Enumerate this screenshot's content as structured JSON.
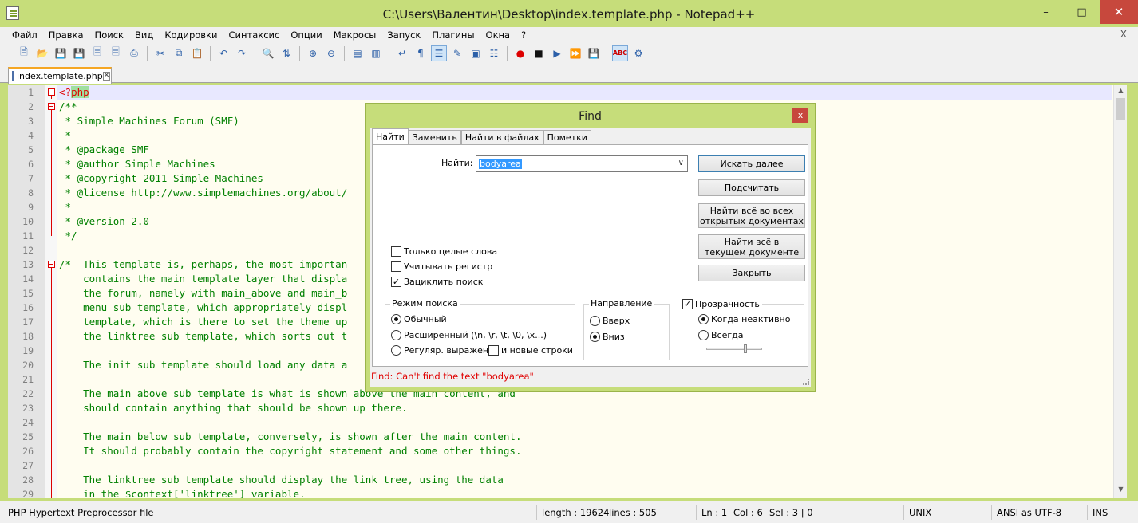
{
  "window": {
    "title": "C:\\Users\\Валентин\\Desktop\\index.template.php - Notepad++"
  },
  "menu": {
    "items": [
      "Файл",
      "Правка",
      "Поиск",
      "Вид",
      "Кодировки",
      "Синтаксис",
      "Опции",
      "Макросы",
      "Запуск",
      "Плагины",
      "Окна",
      "?"
    ],
    "close": "X"
  },
  "tab": {
    "label": "index.template.php"
  },
  "editor": {
    "lines": [
      "<?php",
      "/**",
      " * Simple Machines Forum (SMF)",
      " *",
      " * @package SMF",
      " * @author Simple Machines",
      " * @copyright 2011 Simple Machines",
      " * @license http://www.simplemachines.org/about/",
      " *",
      " * @version 2.0",
      " */",
      "",
      "/*  This template is, perhaps, the most importan",
      "    contains the main template layer that displa",
      "    the forum, namely with main_above and main_b",
      "    menu sub template, which appropriately displ",
      "    template, which is there to set the theme up",
      "    the linktree sub template, which sorts out t",
      "",
      "    The init sub template should load any data a",
      "",
      "    The main_above sub template is what is shown above the main content, and",
      "    should contain anything that should be shown up there.",
      "",
      "    The main_below sub template, conversely, is shown after the main content.",
      "    It should probably contain the copyright statement and some other things.",
      "",
      "    The linktree sub template should display the link tree, using the data",
      "    in the $context['linktree'] variable."
    ]
  },
  "find_dialog": {
    "title": "Find",
    "close": "x",
    "tabs": [
      "Найти",
      "Заменить",
      "Найти в файлах",
      "Пометки"
    ],
    "find_label": "Найти:",
    "find_value": "bodyarea",
    "buttons": {
      "find_next": "Искать далее",
      "count": "Подсчитать",
      "find_all_open_1": "Найти всё во всех",
      "find_all_open_2": "открытых документах",
      "find_all_current_1": "Найти всё в",
      "find_all_current_2": "текущем документе",
      "close": "Закрыть"
    },
    "options": {
      "whole_word": "Только целые слова",
      "match_case": "Учитывать регистр",
      "wrap": "Зациклить поиск"
    },
    "search_mode": {
      "label": "Режим поиска",
      "normal": "Обычный",
      "extended": "Расширенный (\\n, \\r, \\t, \\0, \\x...)",
      "regex": "Регуляр. выражен.",
      "newline": "и новые строки"
    },
    "direction": {
      "label": "Направление",
      "up": "Вверх",
      "down": "Вниз"
    },
    "transparency": {
      "label": "Прозрачность",
      "on_lose_focus": "Когда неактивно",
      "always": "Всегда",
      "level": 0.7
    },
    "status": "Find: Can't find the text \"bodyarea\""
  },
  "statusbar": {
    "filetype": "PHP Hypertext Preprocessor file",
    "length": "length : 19624",
    "lines": "lines : 505",
    "ln": "Ln : 1",
    "col": "Col : 6",
    "sel": "Sel : 3 | 0",
    "eol": "UNIX",
    "encoding": "ANSI as UTF-8",
    "mode": "INS"
  }
}
